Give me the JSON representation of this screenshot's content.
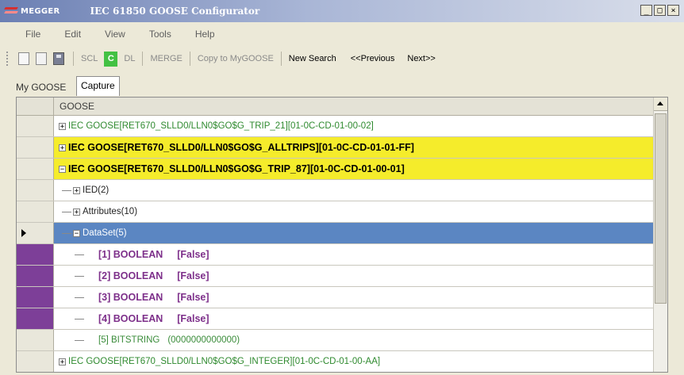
{
  "window": {
    "brand": "MEGGER",
    "title": "IEC 61850 GOOSE Configurator",
    "controls": [
      "_",
      "□",
      "×"
    ]
  },
  "menu": [
    "File",
    "Edit",
    "View",
    "Tools",
    "Help"
  ],
  "toolbar": {
    "icons": [
      "new-icon",
      "open-icon",
      "save-icon"
    ],
    "scl": "SCL",
    "c": "C",
    "dl": "DL",
    "merge": "MERGE",
    "copy": "Copy to MyGOOSE",
    "new_search": "New Search",
    "previous": "<<Previous",
    "next": "Next>>"
  },
  "tabs": {
    "mygoose": "My GOOSE",
    "capture": "Capture",
    "active": "Capture"
  },
  "grid": {
    "header": "GOOSE",
    "rows": [
      {
        "kind": "goose",
        "expander": "+",
        "text": "IEC GOOSE[RET670_SLLD0/LLN0$GO$G_TRIP_21][01-0C-CD-01-00-02]",
        "style": "green"
      },
      {
        "kind": "goose",
        "expander": "+",
        "text": "IEC GOOSE[RET670_SLLD0/LLN0$GO$G_ALLTRIPS][01-0C-CD-01-01-FF]",
        "style": "yellow"
      },
      {
        "kind": "goose",
        "expander": "−",
        "text": "IEC GOOSE[RET670_SLLD0/LLN0$GO$G_TRIP_87][01-0C-CD-01-00-01]",
        "style": "yellow"
      },
      {
        "kind": "node",
        "expander": "+",
        "text": "IED(2)"
      },
      {
        "kind": "node",
        "expander": "+",
        "text": "Attributes(10)"
      },
      {
        "kind": "node",
        "expander": "−",
        "text": "DataSet(5)",
        "selected": true
      },
      {
        "kind": "item",
        "name": "[1] BOOLEAN",
        "value": "[False]",
        "style": "purple"
      },
      {
        "kind": "item",
        "name": "[2] BOOLEAN",
        "value": "[False]",
        "style": "purple"
      },
      {
        "kind": "item",
        "name": "[3] BOOLEAN",
        "value": "[False]",
        "style": "purple"
      },
      {
        "kind": "item",
        "name": "[4] BOOLEAN",
        "value": "[False]",
        "style": "purple"
      },
      {
        "kind": "item",
        "name": "[5] BITSTRING",
        "value": "(0000000000000)",
        "style": "green"
      },
      {
        "kind": "goose",
        "expander": "+",
        "text": "IEC GOOSE[RET670_SLLD0/LLN0$GO$G_INTEGER][01-0C-CD-01-00-AA]",
        "style": "green"
      }
    ]
  },
  "colors": {
    "highlight_yellow": "#f5ec2b",
    "selected_blue": "#5b86c2",
    "purple_marker": "#7d3f98",
    "green_text": "#2f8a2f",
    "c_button": "#43c143"
  }
}
